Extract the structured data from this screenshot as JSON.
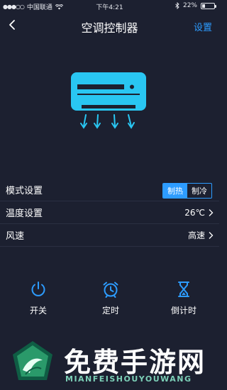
{
  "status_bar": {
    "carrier": "中国联通",
    "time": "下午4:21",
    "battery_percent": "22%",
    "battery_level": 0.22
  },
  "nav": {
    "title": "空调控制器",
    "settings_label": "设置"
  },
  "settings": {
    "mode": {
      "label": "模式设置",
      "options": [
        "制热",
        "制冷"
      ],
      "selected": "制热"
    },
    "temperature": {
      "label": "温度设置",
      "value": "26℃"
    },
    "wind_speed": {
      "label": "风速",
      "value": "高速"
    }
  },
  "actions": {
    "power_label": "开关",
    "timer_label": "定时",
    "countdown_label": "倒计时"
  },
  "colors": {
    "accent": "#2d9cff",
    "background": "#1c2030",
    "ac_cyan": "#29c6f2"
  },
  "watermark": {
    "text": "免费手游网",
    "subtext": "MIANFEISHOUYOUWANG"
  }
}
